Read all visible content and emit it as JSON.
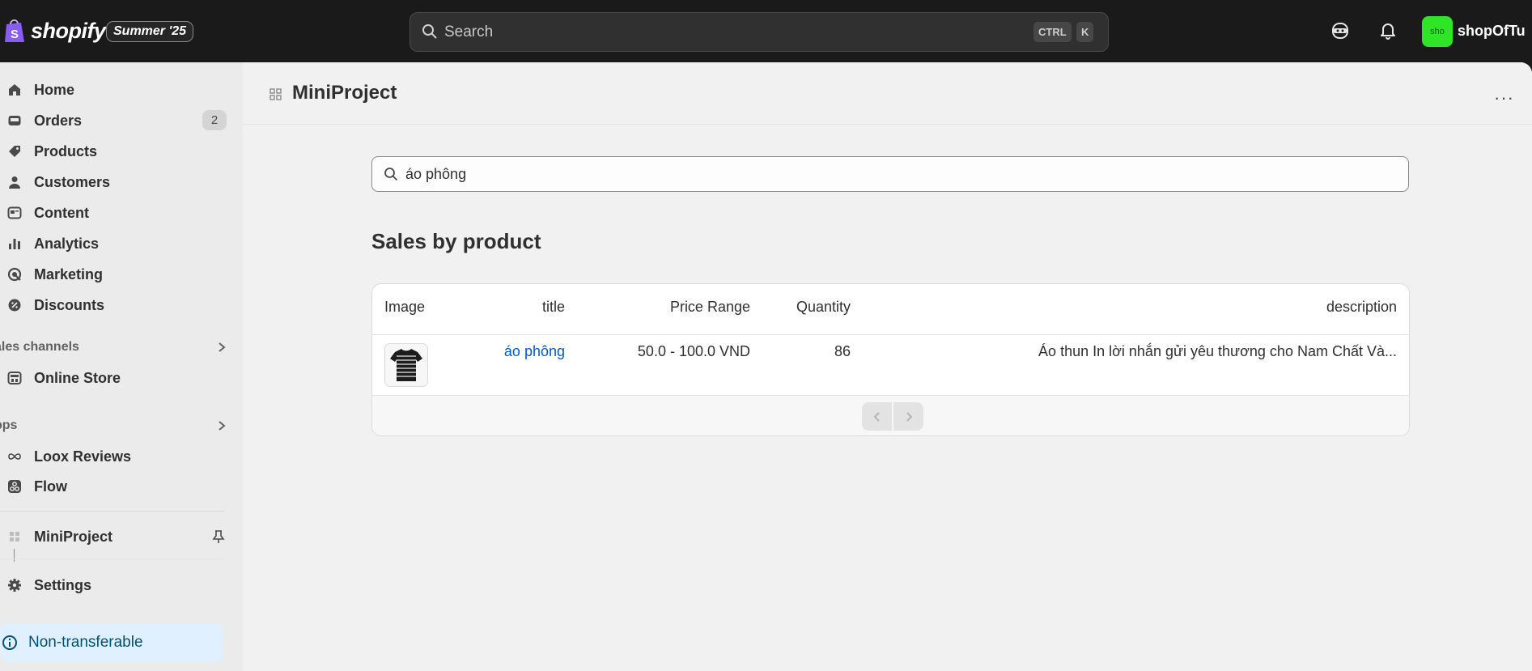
{
  "topbar": {
    "brand": "shopify",
    "season_badge": "Summer '25",
    "search_placeholder": "Search",
    "shortcut_keys": [
      "CTRL",
      "K"
    ],
    "store_avatar_text": "sho",
    "store_name": "shopOfTu",
    "avatar_color": "#2ee627"
  },
  "sidebar": {
    "items": [
      {
        "label": "Home",
        "icon": "home-icon"
      },
      {
        "label": "Orders",
        "icon": "inbox-icon",
        "badge": "2"
      },
      {
        "label": "Products",
        "icon": "tag-icon"
      },
      {
        "label": "Customers",
        "icon": "person-icon"
      },
      {
        "label": "Content",
        "icon": "content-icon"
      },
      {
        "label": "Analytics",
        "icon": "bar-chart-icon"
      },
      {
        "label": "Marketing",
        "icon": "target-icon"
      },
      {
        "label": "Discounts",
        "icon": "discount-icon"
      }
    ],
    "sales_channels_label": "ales channels",
    "online_store_label": "Online Store",
    "apps_label": "pps",
    "apps": [
      {
        "label": "Loox Reviews",
        "icon": "infinity-icon"
      },
      {
        "label": "Flow",
        "icon": "flow-icon"
      }
    ],
    "pinned_app_label": "MiniProject",
    "settings_label": "Settings",
    "nontransferable_label": "Non-transferable"
  },
  "page": {
    "title": "MiniProject",
    "more_label": "···",
    "search_value": "áo phông",
    "section_title": "Sales by product",
    "table": {
      "headers": [
        "Image",
        "title",
        "Price Range",
        "Quantity",
        "description"
      ],
      "rows": [
        {
          "title": "áo phông",
          "price_range": "50.0 - 100.0 VND",
          "quantity": "86",
          "description": "Áo thun In lời nhắn gửi yêu thương cho Nam Chất Và..."
        }
      ]
    }
  },
  "colors": {
    "link": "#005bd3",
    "nontransferable_bg": "#e0f0ff"
  }
}
